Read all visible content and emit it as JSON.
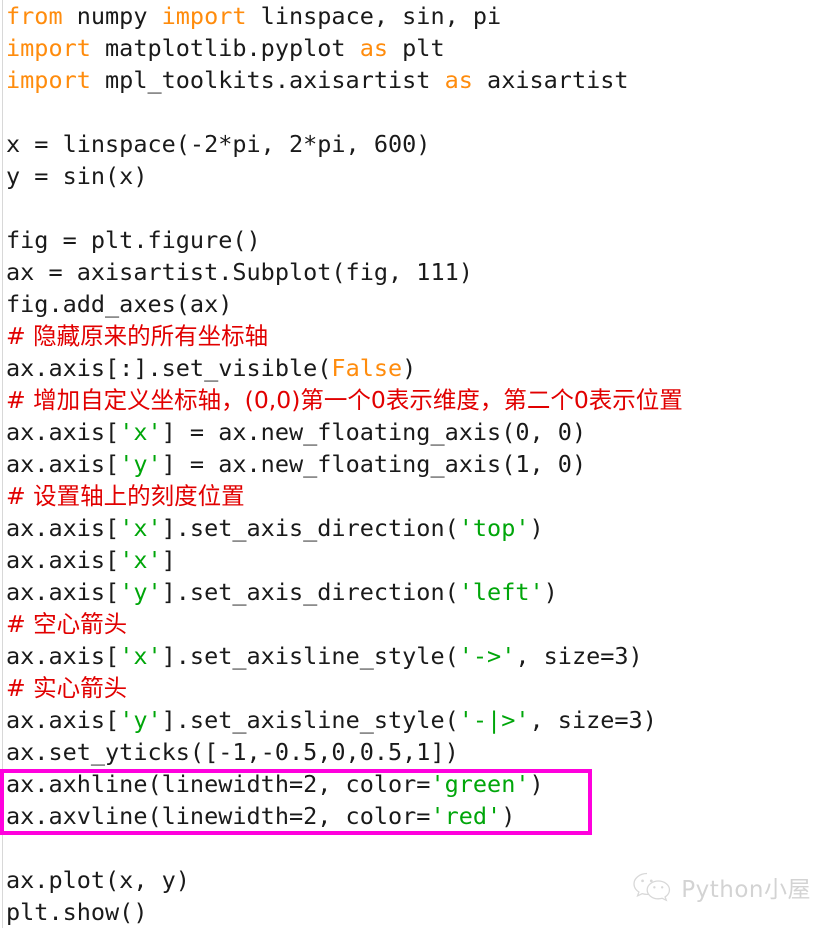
{
  "document": {
    "kind": "python-source-screenshot",
    "language": "Python"
  },
  "colors": {
    "background": "#ffffff",
    "text": "#1a1a1a",
    "keyword": "#ff8c0d",
    "string": "#00a60a",
    "comment": "#e10000",
    "highlight_box": "#ff00dd",
    "left_rule": "#d8d8d8",
    "watermark": "#8d8d8d"
  },
  "code": {
    "lines": [
      {
        "n": 1,
        "segments": [
          {
            "t": "from",
            "c": "kw"
          },
          {
            "t": " numpy ",
            "c": "plain"
          },
          {
            "t": "import",
            "c": "kw"
          },
          {
            "t": " linspace, sin, pi",
            "c": "plain"
          }
        ]
      },
      {
        "n": 2,
        "segments": [
          {
            "t": "import",
            "c": "kw"
          },
          {
            "t": " matplotlib.pyplot ",
            "c": "plain"
          },
          {
            "t": "as",
            "c": "kw"
          },
          {
            "t": " plt",
            "c": "plain"
          }
        ]
      },
      {
        "n": 3,
        "segments": [
          {
            "t": "import",
            "c": "kw"
          },
          {
            "t": " mpl_toolkits.axisartist ",
            "c": "plain"
          },
          {
            "t": "as",
            "c": "kw"
          },
          {
            "t": " axisartist",
            "c": "plain"
          }
        ]
      },
      {
        "n": 4,
        "segments": []
      },
      {
        "n": 5,
        "segments": [
          {
            "t": "x = linspace(-2*pi, 2*pi, 600)",
            "c": "plain"
          }
        ]
      },
      {
        "n": 6,
        "segments": [
          {
            "t": "y = sin(x)",
            "c": "plain"
          }
        ]
      },
      {
        "n": 7,
        "segments": []
      },
      {
        "n": 8,
        "segments": [
          {
            "t": "fig = plt.figure()",
            "c": "plain"
          }
        ]
      },
      {
        "n": 9,
        "segments": [
          {
            "t": "ax = axisartist.Subplot(fig, 111)",
            "c": "plain"
          }
        ]
      },
      {
        "n": 10,
        "segments": [
          {
            "t": "fig.add_axes(ax)",
            "c": "plain"
          }
        ]
      },
      {
        "n": 11,
        "segments": [
          {
            "t": "# 隐藏原来的所有坐标轴",
            "c": "comment",
            "cjk": true
          }
        ]
      },
      {
        "n": 12,
        "segments": [
          {
            "t": "ax.axis[:].set_visible(",
            "c": "plain"
          },
          {
            "t": "False",
            "c": "kw"
          },
          {
            "t": ")",
            "c": "plain"
          }
        ]
      },
      {
        "n": 13,
        "segments": [
          {
            "t": "# 增加自定义坐标轴，(0,0)第一个0表示维度，第二个0表示位置",
            "c": "comment",
            "cjk": true
          }
        ]
      },
      {
        "n": 14,
        "segments": [
          {
            "t": "ax.axis[",
            "c": "plain"
          },
          {
            "t": "'x'",
            "c": "str"
          },
          {
            "t": "] = ax.new_floating_axis(0, 0)",
            "c": "plain"
          }
        ]
      },
      {
        "n": 15,
        "segments": [
          {
            "t": "ax.axis[",
            "c": "plain"
          },
          {
            "t": "'y'",
            "c": "str"
          },
          {
            "t": "] = ax.new_floating_axis(1, 0)",
            "c": "plain"
          }
        ]
      },
      {
        "n": 16,
        "segments": [
          {
            "t": "# 设置轴上的刻度位置",
            "c": "comment",
            "cjk": true
          }
        ]
      },
      {
        "n": 17,
        "segments": [
          {
            "t": "ax.axis[",
            "c": "plain"
          },
          {
            "t": "'x'",
            "c": "str"
          },
          {
            "t": "].set_axis_direction(",
            "c": "plain"
          },
          {
            "t": "'top'",
            "c": "str"
          },
          {
            "t": ")",
            "c": "plain"
          }
        ]
      },
      {
        "n": 18,
        "segments": [
          {
            "t": "ax.axis[",
            "c": "plain"
          },
          {
            "t": "'x'",
            "c": "str"
          },
          {
            "t": "]",
            "c": "plain"
          }
        ]
      },
      {
        "n": 19,
        "segments": [
          {
            "t": "ax.axis[",
            "c": "plain"
          },
          {
            "t": "'y'",
            "c": "str"
          },
          {
            "t": "].set_axis_direction(",
            "c": "plain"
          },
          {
            "t": "'left'",
            "c": "str"
          },
          {
            "t": ")",
            "c": "plain"
          }
        ]
      },
      {
        "n": 20,
        "segments": [
          {
            "t": "# 空心箭头",
            "c": "comment",
            "cjk": true
          }
        ]
      },
      {
        "n": 21,
        "segments": [
          {
            "t": "ax.axis[",
            "c": "plain"
          },
          {
            "t": "'x'",
            "c": "str"
          },
          {
            "t": "].set_axisline_style(",
            "c": "plain"
          },
          {
            "t": "'->'",
            "c": "str"
          },
          {
            "t": ", size=3)",
            "c": "plain"
          }
        ]
      },
      {
        "n": 22,
        "segments": [
          {
            "t": "# 实心箭头",
            "c": "comment",
            "cjk": true
          }
        ]
      },
      {
        "n": 23,
        "segments": [
          {
            "t": "ax.axis[",
            "c": "plain"
          },
          {
            "t": "'y'",
            "c": "str"
          },
          {
            "t": "].set_axisline_style(",
            "c": "plain"
          },
          {
            "t": "'-|>'",
            "c": "str"
          },
          {
            "t": ", size=3)",
            "c": "plain"
          }
        ]
      },
      {
        "n": 24,
        "segments": [
          {
            "t": "ax.set_yticks([-1,-0.5,0,0.5,1])",
            "c": "plain"
          }
        ]
      },
      {
        "n": 25,
        "segments": [
          {
            "t": "ax.axhline(linewidth=2, color=",
            "c": "plain"
          },
          {
            "t": "'green'",
            "c": "str"
          },
          {
            "t": ")",
            "c": "plain"
          }
        ]
      },
      {
        "n": 26,
        "segments": [
          {
            "t": "ax.axvline(linewidth=2, color=",
            "c": "plain"
          },
          {
            "t": "'red'",
            "c": "str"
          },
          {
            "t": ")",
            "c": "plain"
          }
        ]
      },
      {
        "n": 27,
        "segments": []
      },
      {
        "n": 28,
        "segments": [
          {
            "t": "ax.plot(x, y)",
            "c": "plain"
          }
        ]
      },
      {
        "n": 29,
        "segments": [
          {
            "t": "plt.show()",
            "c": "plain"
          }
        ]
      }
    ],
    "highlighted_line_numbers": [
      25,
      26
    ]
  },
  "watermark": {
    "text": "Python小屋",
    "icon": "wechat-icon"
  }
}
